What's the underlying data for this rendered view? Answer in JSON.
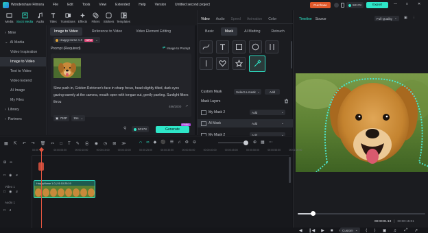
{
  "titlebar": {
    "app_name": "Wondershare Filmora",
    "menu": [
      "File",
      "Edit",
      "Tools",
      "View",
      "Extended",
      "Help",
      "Version"
    ],
    "project_title": "Untitled second project",
    "purchase": "Purchase",
    "credits": "50178",
    "export": "Export"
  },
  "toolbar": {
    "items": [
      "Media",
      "Stock Media",
      "Audio",
      "Titles",
      "Transitions",
      "Effects",
      "Filters",
      "Stickers",
      "Templates"
    ],
    "active_index": 1
  },
  "sidebar": {
    "items": [
      {
        "label": "Mine",
        "type": "group"
      },
      {
        "label": "AI Media",
        "type": "group"
      },
      {
        "label": "Video Inspiration",
        "type": "sub"
      },
      {
        "label": "Image to Video",
        "type": "sub",
        "selected": true
      },
      {
        "label": "Text to Video",
        "type": "sub"
      },
      {
        "label": "Video Extend",
        "type": "sub"
      },
      {
        "label": "AI Image",
        "type": "sub"
      },
      {
        "label": "My Files",
        "type": "sub"
      },
      {
        "label": "Library",
        "type": "group"
      },
      {
        "label": "Partners",
        "type": "group"
      }
    ]
  },
  "center": {
    "tabs": [
      "Image to Video",
      "Reference to Video",
      "Video Element Editing"
    ],
    "model": "HappyHorse 1.0",
    "model_badge": "NEW",
    "prompt_label": "Prompt (Required)",
    "image_to_prompt": "Image to Prompt",
    "prompt_text": "Slow push-in, Golden Retriever's face in sharp focus, head slightly tilted, dark eyes gazing warmly at the camera, mouth open with tongue out, gently panting. Sunlight filters throu",
    "char_count": "486/2000",
    "resolution": "720P",
    "duration": "15s",
    "credit_cost": "50178",
    "generate": "Generate",
    "generate_badge": "FREE"
  },
  "props": {
    "tabs": [
      "Video",
      "Audio",
      "Speed",
      "Animation",
      "Color"
    ],
    "tabs_active": 0,
    "subtabs": [
      "Basic",
      "Mask",
      "AI Matting",
      "Retouch"
    ],
    "subtabs_active": 1,
    "custom_mask_label": "Custom Mask",
    "select_mask": "Select a mask",
    "add": "Add",
    "mask_layers_label": "Mask Layers",
    "layers": [
      {
        "name": "My Mask 2",
        "action": "Add"
      },
      {
        "name": "AI Mask",
        "action": "Add"
      },
      {
        "name": "My Mask 2",
        "action": "Add"
      }
    ]
  },
  "preview": {
    "tabs": [
      "Timeline",
      "Source"
    ],
    "quality": "Full Quality",
    "current_time": "00:00:01:19",
    "total_time": "00:00:15:01",
    "zoom": "Custom",
    "progress": 0.12
  },
  "timeline": {
    "ruler": [
      "00:00",
      "00:00:05:00",
      "00:00:10:00",
      "00:00:15:00",
      "00:00:20:00",
      "00:00:25:00",
      "00:00:30:00",
      "00:00:35:00",
      "00:00:40:00",
      "00:00:45:00",
      "00:00:50:00",
      "00:00:55:00",
      "00:01:00:00"
    ],
    "clip_label": "HappyHorse 1.0 | 01:10:25:19",
    "tracks": [
      "Video 1",
      "Audio 1"
    ],
    "playhead_ratio": 0.135
  }
}
